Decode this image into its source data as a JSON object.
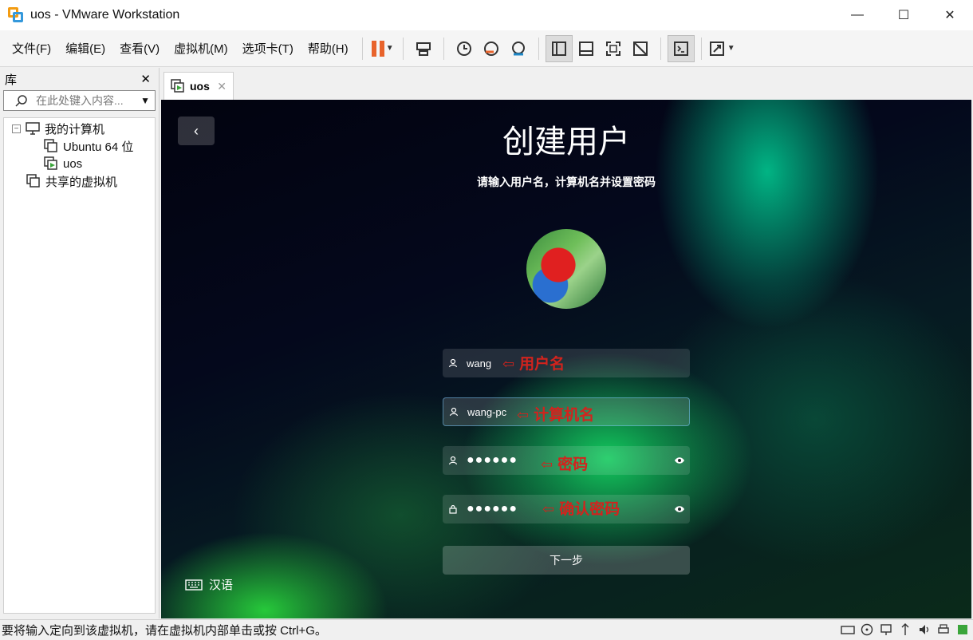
{
  "window": {
    "title": "uos - VMware Workstation",
    "minimize": "—",
    "maximize": "☐",
    "close": "✕"
  },
  "menu": {
    "items": [
      "文件(F)",
      "编辑(E)",
      "查看(V)",
      "虚拟机(M)",
      "选项卡(T)",
      "帮助(H)"
    ]
  },
  "library": {
    "title": "库",
    "close": "✕",
    "search_placeholder": "在此处键入内容...",
    "tree": {
      "my_computer": "我的计算机",
      "vm1": "Ubuntu 64 位",
      "vm2": "uos",
      "shared": "共享的虚拟机"
    }
  },
  "tab": {
    "label": "uos",
    "close": "✕"
  },
  "vm_screen": {
    "back": "‹",
    "title": "创建用户",
    "subtitle": "请输入用户名，计算机名并设置密码",
    "fields": {
      "username": "wang",
      "hostname": "wang-pc",
      "password": "●●●●●●",
      "confirm_password": "●●●●●●"
    },
    "annotations": {
      "arrow": "⇦",
      "username": "用户名",
      "hostname": "计算机名",
      "password": "密码",
      "confirm": "确认密码"
    },
    "next_button": "下一步",
    "language": "汉语"
  },
  "statusbar": {
    "message": "要将输入定向到该虚拟机，请在虚拟机内部单击或按 Ctrl+G。"
  },
  "colors": {
    "annotation_red": "#d2231d",
    "pause_orange": "#e8632b"
  }
}
